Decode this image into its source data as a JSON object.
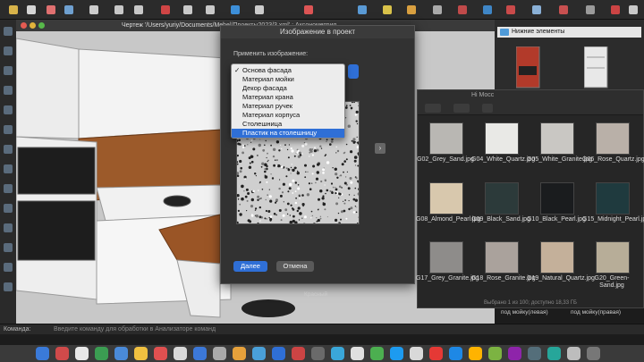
{
  "drawing_window": {
    "title": "Чертеж '/Users/yuriy/Documents/Mebel/Проекты2023/3.xml' : Аксонометрия"
  },
  "dialog": {
    "title": "Изображение в проект",
    "apply_label": "Применить изображение:",
    "ok_label": "Далее",
    "cancel_label": "Отмена",
    "options": [
      "Основа фасада",
      "Материал мойки",
      "Декор фасада",
      "Материал крана",
      "Материал ручек",
      "Материал корпуса",
      "Столешница",
      "Пластик на столешницу"
    ],
    "checked_index": 0,
    "highlighted_index": 7
  },
  "library": {
    "header": "Нижние элементы"
  },
  "finder": {
    "title_partial": "Hi Mocc",
    "status": "Выбрано 1 из 100; доступно 18,33 ГБ",
    "files": [
      {
        "name": "G02_Grey_Sand.jpg",
        "color": "#b9b7b3"
      },
      {
        "name": "G04_White_Quartz.jpg",
        "color": "#e9e9e6"
      },
      {
        "name": "G05_White_Granite.jpg",
        "color": "#c9c7c3"
      },
      {
        "name": "G06_Rose_Quartz.jpg",
        "color": "#b9b0a8"
      },
      {
        "name": "G08_Almond_Pearl.jpg",
        "color": "#d8c8ad"
      },
      {
        "name": "G09_Black_Sand.jpg",
        "color": "#2c3a3a"
      },
      {
        "name": "G10_Black_Pearl.jpg",
        "color": "#1a1c1e"
      },
      {
        "name": "G15_Midnight_Pearl.jpg",
        "color": "#1f3a3e"
      },
      {
        "name": "G17_Grey_Granite.jpg",
        "color": "#8e8c8a"
      },
      {
        "name": "G18_Rose_Granite.jpg",
        "color": "#aaa29c"
      },
      {
        "name": "G19_Natural_Quartz.jpg",
        "color": "#c4b09a"
      },
      {
        "name": "G20_Green-Sand.jpg",
        "color": "#b7ad98"
      }
    ]
  },
  "side_labels": {
    "left_bottom": "Красный",
    "under_left": "под мойку(левая)",
    "under_right": "под мойку(правая)"
  },
  "command_bar": {
    "label": "Команда:",
    "hint": "Введите команду для обработки в Анализаторе команд"
  },
  "colors": {
    "accent": "#2f6fd6",
    "selection": "#2f6fd6"
  }
}
